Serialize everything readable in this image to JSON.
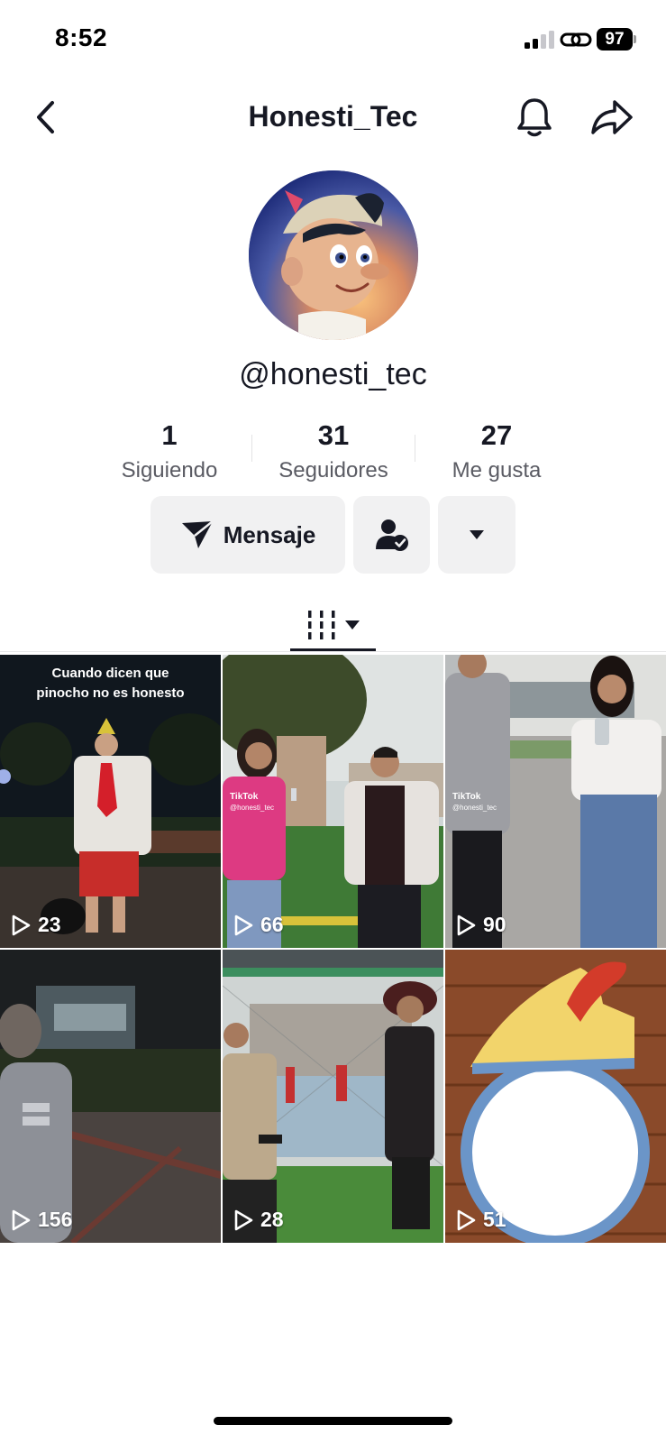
{
  "status_bar": {
    "time": "8:52",
    "battery": "97",
    "icons": [
      "signal-icon",
      "link-icon",
      "battery-icon"
    ]
  },
  "nav": {
    "title": "Honesti_Tec",
    "icons": [
      "back-chevron-icon",
      "bell-icon",
      "share-arrow-icon"
    ]
  },
  "profile": {
    "handle": "@honesti_tec",
    "stats": [
      {
        "value": "1",
        "label": "Siguiendo"
      },
      {
        "value": "31",
        "label": "Seguidores"
      },
      {
        "value": "27",
        "label": "Me gusta"
      }
    ]
  },
  "actions": {
    "message_label": "Mensaje",
    "icons": [
      "send-icon",
      "user-check-icon",
      "caret-down-icon"
    ]
  },
  "tabs": {
    "icons": [
      "grid-icon",
      "caret-down-icon"
    ]
  },
  "videos": [
    {
      "views": "23",
      "caption": "Cuando dicen que\npinocho no es honesto",
      "watermark": ""
    },
    {
      "views": "66",
      "caption": "",
      "watermark": "TikTok",
      "watermark_handle": "@honesti_tec"
    },
    {
      "views": "90",
      "caption": "",
      "watermark": "TikTok",
      "watermark_handle": "@honesti_tec"
    },
    {
      "views": "156",
      "caption": "",
      "watermark": ""
    },
    {
      "views": "28",
      "caption": "",
      "watermark": ""
    },
    {
      "views": "51",
      "caption": "",
      "watermark": ""
    }
  ],
  "colors": {
    "text_primary": "#161823",
    "text_secondary": "#5a5b63",
    "button_bg": "#f1f1f2"
  }
}
